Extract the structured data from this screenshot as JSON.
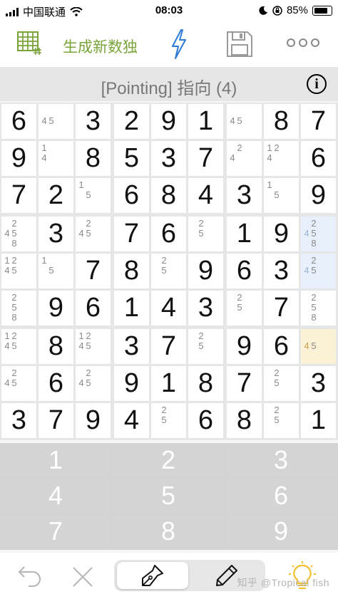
{
  "status_bar": {
    "carrier": "中国联通",
    "time": "08:03",
    "battery": "85%"
  },
  "toolbar": {
    "new_game_label": "生成新数独",
    "icons": [
      "grid-hash-icon",
      "lightning-icon",
      "save-disk-icon",
      "more-dots-icon"
    ]
  },
  "hint": {
    "title": "[Pointing] 指向 (4)",
    "info_label": "i"
  },
  "board": {
    "values": [
      [
        6,
        0,
        3,
        2,
        9,
        1,
        0,
        8,
        7
      ],
      [
        9,
        0,
        8,
        5,
        3,
        7,
        0,
        0,
        6
      ],
      [
        7,
        2,
        0,
        6,
        8,
        4,
        3,
        0,
        9
      ],
      [
        0,
        3,
        0,
        7,
        6,
        0,
        1,
        9,
        0
      ],
      [
        0,
        0,
        7,
        8,
        0,
        9,
        6,
        3,
        0
      ],
      [
        0,
        9,
        6,
        1,
        4,
        3,
        0,
        7,
        0
      ],
      [
        0,
        8,
        0,
        3,
        7,
        0,
        9,
        6,
        0
      ],
      [
        0,
        6,
        0,
        9,
        1,
        8,
        7,
        0,
        3
      ],
      [
        3,
        7,
        9,
        4,
        0,
        6,
        8,
        0,
        1
      ]
    ],
    "candidates": [
      [
        [],
        [
          4,
          5
        ],
        [],
        [],
        [],
        [],
        [
          4,
          5
        ],
        [],
        []
      ],
      [
        [],
        [
          1,
          4
        ],
        [],
        [],
        [],
        [],
        [
          2,
          4
        ],
        [
          1,
          2,
          4
        ],
        []
      ],
      [
        [],
        [],
        [
          1,
          5
        ],
        [],
        [],
        [],
        [],
        [
          1,
          5
        ],
        []
      ],
      [
        [
          2,
          4,
          5,
          8
        ],
        [],
        [
          2,
          4,
          5
        ],
        [],
        [],
        [
          2,
          5
        ],
        [],
        [],
        [
          2,
          4,
          5,
          8
        ]
      ],
      [
        [
          1,
          2,
          4,
          5
        ],
        [
          1,
          5
        ],
        [],
        [],
        [
          2,
          5
        ],
        [],
        [],
        [],
        [
          2,
          4,
          5
        ]
      ],
      [
        [
          2,
          5,
          8
        ],
        [],
        [],
        [],
        [],
        [],
        [
          2,
          5
        ],
        [],
        [
          2,
          5,
          8
        ]
      ],
      [
        [
          1,
          2,
          4,
          5
        ],
        [],
        [
          1,
          2,
          4,
          5
        ],
        [],
        [],
        [
          2,
          5
        ],
        [],
        [],
        [
          4,
          5
        ]
      ],
      [
        [
          2,
          4,
          5
        ],
        [],
        [
          2,
          4,
          5
        ],
        [],
        [],
        [],
        [],
        [
          2,
          5
        ],
        []
      ],
      [
        [],
        [],
        [],
        [],
        [
          2,
          5
        ],
        [],
        [],
        [
          2,
          5
        ],
        []
      ]
    ],
    "highlights": {
      "blue": [
        [
          3,
          8
        ],
        [
          4,
          8
        ]
      ],
      "yellow": [
        [
          6,
          8
        ]
      ]
    }
  },
  "number_pad": {
    "keys": [
      "1",
      "2",
      "3",
      "4",
      "5",
      "6",
      "7",
      "8",
      "9"
    ]
  },
  "bottom_bar": {
    "icons": [
      "undo-icon",
      "clear-icon",
      "pen-icon",
      "pencil-icon",
      "lightbulb-icon"
    ],
    "watermark": "知乎 @Tropical fish"
  },
  "colors": {
    "accent_green": "#7aa43a",
    "bolt_blue": "#2e7bd6",
    "bulb_yellow": "#f2c12e",
    "highlight_blue": "#e8f0fb",
    "highlight_yellow": "#fbf2d6"
  }
}
